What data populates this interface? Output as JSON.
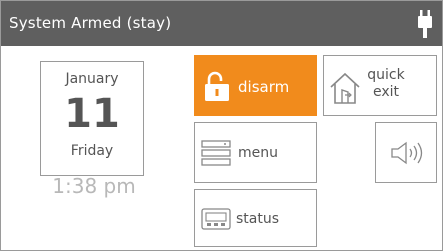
{
  "header": {
    "status_title": "System Armed (stay)",
    "power_icon": "plug-icon"
  },
  "clock": {
    "month": "January",
    "day": "11",
    "weekday": "Friday",
    "time": "1:38 pm"
  },
  "buttons": {
    "disarm": {
      "label": "disarm",
      "icon": "unlock-icon"
    },
    "quick_exit": {
      "label": "quick exit",
      "icon": "house-exit-icon"
    },
    "menu": {
      "label": "menu",
      "icon": "menu-list-icon"
    },
    "sound": {
      "icon": "speaker-icon"
    },
    "status": {
      "label": "status",
      "icon": "status-panel-icon"
    }
  },
  "colors": {
    "header_bg": "#5f5f5f",
    "accent": "#f18b1c",
    "border": "#9a9a9a",
    "text": "#555555",
    "time_text": "#b8b8b8"
  }
}
